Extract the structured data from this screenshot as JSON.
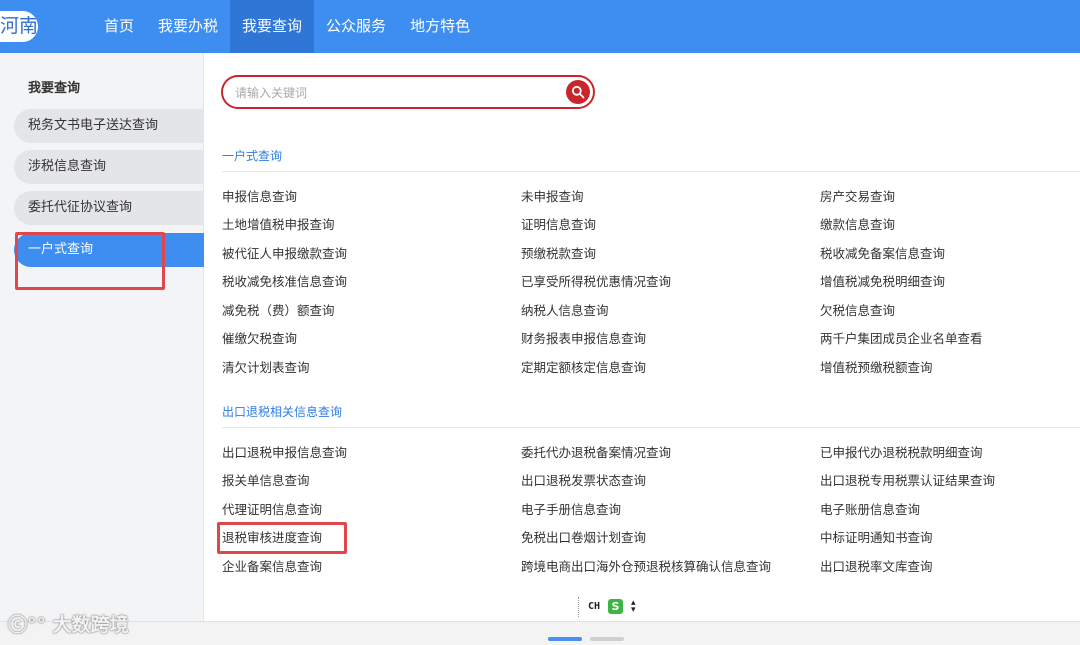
{
  "header": {
    "logo_text": "河南",
    "nav": [
      "首页",
      "我要办税",
      "我要查询",
      "公众服务",
      "地方特色"
    ],
    "active_nav": "我要查询"
  },
  "sidebar": {
    "title": "我要查询",
    "items": [
      "税务文书电子送达查询",
      "涉税信息查询",
      "委托代征协议查询",
      "一户式查询"
    ],
    "active_item": "一户式查询"
  },
  "search": {
    "placeholder": "请输入关键词",
    "value": ""
  },
  "sections": [
    {
      "title": "一户式查询",
      "rows": [
        [
          "申报信息查询",
          "未申报查询",
          "房产交易查询"
        ],
        [
          "土地增值税申报查询",
          "证明信息查询",
          "缴款信息查询"
        ],
        [
          "被代征人申报缴款查询",
          "预缴税款查询",
          "税收减免备案信息查询"
        ],
        [
          "税收减免核准信息查询",
          "已享受所得税优惠情况查询",
          "增值税减免税明细查询"
        ],
        [
          "减免税（费）额查询",
          "纳税人信息查询",
          "欠税信息查询"
        ],
        [
          "催缴欠税查询",
          "财务报表申报信息查询",
          "两千户集团成员企业名单查看"
        ],
        [
          "清欠计划表查询",
          "定期定额核定信息查询",
          "增值税预缴税额查询"
        ]
      ]
    },
    {
      "title": "出口退税相关信息查询",
      "rows": [
        [
          "出口退税申报信息查询",
          "委托代办退税备案情况查询",
          "已申报代办退税税款明细查询"
        ],
        [
          "报关单信息查询",
          "出口退税发票状态查询",
          "出口退税专用税票认证结果查询"
        ],
        [
          "代理证明信息查询",
          "电子手册信息查询",
          "电子账册信息查询"
        ],
        [
          "退税审核进度查询",
          "免税出口卷烟计划查询",
          "中标证明通知书查询"
        ],
        [
          "企业备案信息查询",
          "跨境电商出口海外仓预退税核算确认信息查询",
          "出口退税率文库查询"
        ]
      ]
    }
  ],
  "ime": {
    "mode": "CH",
    "logo": "S"
  },
  "pagination": {
    "total": 2,
    "current": 1
  },
  "watermark": "大数跨境",
  "colors": {
    "nav_bg": "#3d8ef0",
    "nav_active": "#2f76d6",
    "search_border": "#c9252c",
    "section_title": "#2f7de1",
    "highlight_box": "#e0474c"
  }
}
